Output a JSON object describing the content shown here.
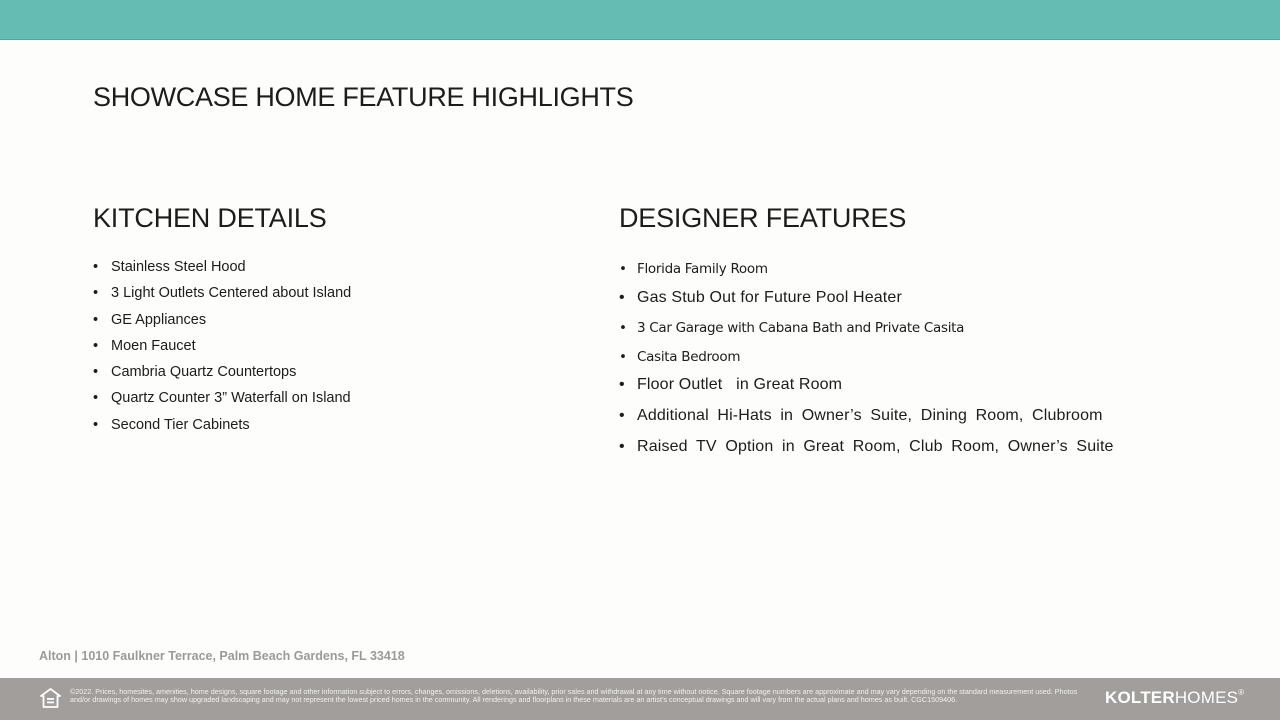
{
  "header": {
    "title": "SHOWCASE HOME FEATURE HIGHLIGHTS"
  },
  "kitchen": {
    "heading": "KITCHEN DETAILS",
    "items": [
      "Stainless Steel Hood",
      "3 Light Outlets Centered about Island",
      "GE Appliances",
      "Moen Faucet",
      "Cambria Quartz Countertops",
      "Quartz Counter 3” Waterfall on Island",
      "Second Tier Cabinets"
    ]
  },
  "designer": {
    "heading": "DESIGNER FEATURES",
    "items": [
      "Florida Family Room",
      "Gas Stub Out for Future Pool Heater",
      "3 Car Garage with Cabana Bath and Private Casita",
      "Casita Bedroom",
      "Floor Outlet   in Great Room",
      "Additional Hi-Hats in Owner’s Suite, Dining Room, Clubroom",
      "Raised TV Option in Great Room, Club Room, Owner’s Suite"
    ]
  },
  "footer": {
    "address": "Alton | 1010 Faulkner Terrace, Palm Beach Gardens, FL 33418",
    "disclaimer": "©2022. Prices, homesites, amenities, home designs, square footage and other information subject to errors, changes, omissions, deletions, availability, prior sales and withdrawal at any time without notice. Square footage numbers are approximate and may vary depending on the standard measurement used. Photos and/or drawings of homes may show upgraded landscaping and may not represent the lowest priced homes in the community. All renderings and floorplans in these materials are an artist’s conceptual drawings and will vary from the actual plans and homes as built. CGC1509406.",
    "brand_bold": "KOLTER",
    "brand_light": "HOMES",
    "brand_mark": "®",
    "equal_housing_icon": "equal-housing-icon"
  },
  "colors": {
    "top_band": "#65bcb2",
    "footer_band": "#a19e9b",
    "background": "#fdfdfb",
    "text": "#1c1c1c"
  }
}
